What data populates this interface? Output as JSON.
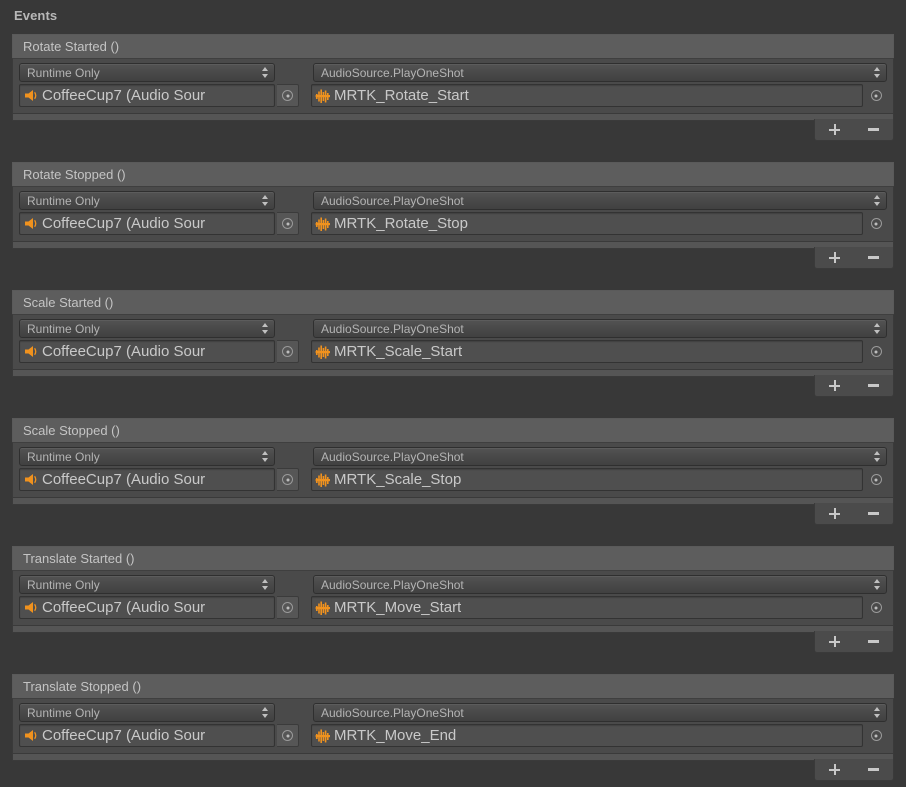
{
  "panel": {
    "section_title": "Events",
    "background_color": "#383838",
    "header_color": "#5d5d5d",
    "body_color": "#4a4a4a",
    "accent_color": "#f0921e"
  },
  "controls": {
    "add_label": "+",
    "remove_label": "−",
    "picker_icon": "target-select-icon",
    "popup_icon": "updown-arrows-icon",
    "audiosource_icon": "audio-source-speaker-icon",
    "audioclip_icon": "audio-clip-waveform-icon"
  },
  "events": [
    {
      "name": "Rotate Started ()",
      "calls": [
        {
          "timing": "Runtime Only",
          "function": "AudioSource.PlayOneShot",
          "target_object": "CoffeeCup7 (Audio Sour",
          "argument": "MRTK_Rotate_Start"
        }
      ]
    },
    {
      "name": "Rotate Stopped ()",
      "calls": [
        {
          "timing": "Runtime Only",
          "function": "AudioSource.PlayOneShot",
          "target_object": "CoffeeCup7 (Audio Sour",
          "argument": "MRTK_Rotate_Stop"
        }
      ]
    },
    {
      "name": "Scale Started ()",
      "calls": [
        {
          "timing": "Runtime Only",
          "function": "AudioSource.PlayOneShot",
          "target_object": "CoffeeCup7 (Audio Sour",
          "argument": "MRTK_Scale_Start"
        }
      ]
    },
    {
      "name": "Scale Stopped ()",
      "calls": [
        {
          "timing": "Runtime Only",
          "function": "AudioSource.PlayOneShot",
          "target_object": "CoffeeCup7 (Audio Sour",
          "argument": "MRTK_Scale_Stop"
        }
      ]
    },
    {
      "name": "Translate Started ()",
      "calls": [
        {
          "timing": "Runtime Only",
          "function": "AudioSource.PlayOneShot",
          "target_object": "CoffeeCup7 (Audio Sour",
          "argument": "MRTK_Move_Start"
        }
      ]
    },
    {
      "name": "Translate Stopped ()",
      "calls": [
        {
          "timing": "Runtime Only",
          "function": "AudioSource.PlayOneShot",
          "target_object": "CoffeeCup7 (Audio Sour",
          "argument": "MRTK_Move_End"
        }
      ]
    }
  ]
}
